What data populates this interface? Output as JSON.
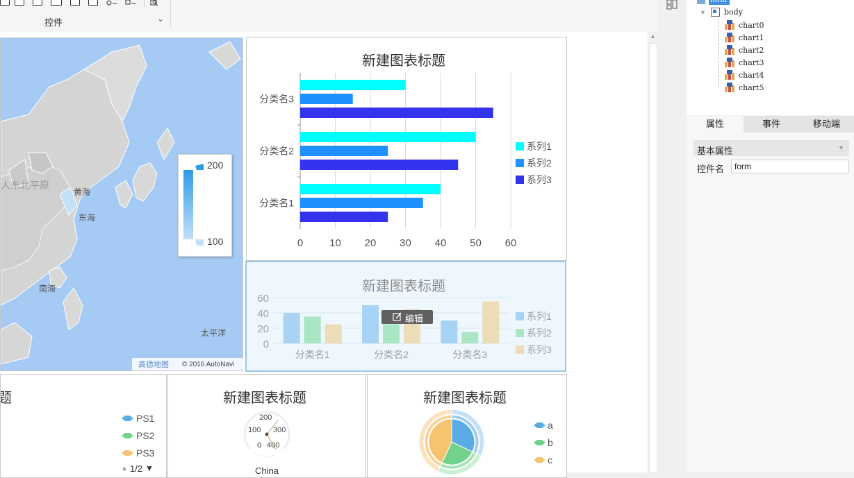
{
  "toolbar": {
    "section_label": "控件",
    "icons": [
      "insert-icon",
      "frame-icon",
      "layout-icon",
      "grid-icon",
      "image-icon",
      "text-icon",
      "radio-icon",
      "checkbox-icon",
      "preview-icon"
    ]
  },
  "map": {
    "labels": {
      "yellow_sea": "黄海",
      "east_sea": "东海",
      "south_sea": "南海",
      "pacific": "太平洋",
      "region": "人东北平原"
    },
    "legend": {
      "max": "200",
      "min": "100"
    },
    "attribution": {
      "provider": "高德地图",
      "copyright": "© 2016 AutoNavi"
    }
  },
  "chart_data": [
    {
      "type": "bar",
      "orientation": "horizontal",
      "title": "新建图表标题",
      "categories": [
        "分类名1",
        "分类名2",
        "分类名3"
      ],
      "series": [
        {
          "name": "系列1",
          "values": [
            40,
            50,
            30
          ],
          "color": "#00ffff"
        },
        {
          "name": "系列2",
          "values": [
            35,
            25,
            15
          ],
          "color": "#1e90ff"
        },
        {
          "name": "系列3",
          "values": [
            25,
            45,
            55
          ],
          "color": "#3333ee"
        }
      ],
      "xlim": [
        0,
        60
      ],
      "ticks": [
        "0",
        "10",
        "20",
        "30",
        "40",
        "50",
        "60"
      ],
      "grid": true,
      "legend_position": "right"
    },
    {
      "type": "bar",
      "orientation": "vertical",
      "title": "新建图表标题",
      "categories": [
        "分类名1",
        "分类名2",
        "分类名3"
      ],
      "series": [
        {
          "name": "系列1",
          "values": [
            40,
            50,
            30
          ],
          "color": "#a9d3f5"
        },
        {
          "name": "系列2",
          "values": [
            35,
            25,
            15
          ],
          "color": "#a8e6c4"
        },
        {
          "name": "系列3",
          "values": [
            25,
            45,
            55
          ],
          "color": "#ecdcb8"
        }
      ],
      "ylim": [
        0,
        60
      ],
      "ticks": [
        "0",
        "20",
        "40",
        "60"
      ],
      "grid": true,
      "legend_position": "right",
      "selected": true
    },
    {
      "type": "gauge",
      "title": "新建图表标题",
      "tick_labels": [
        "0",
        "100",
        "200",
        "300",
        "400"
      ],
      "category": "China"
    },
    {
      "type": "pie",
      "title": "新建图表标题",
      "legend": [
        {
          "name": "a",
          "color": "#5aace6"
        },
        {
          "name": "b",
          "color": "#72d28c"
        },
        {
          "name": "c",
          "color": "#f5c46e"
        }
      ],
      "legend_position": "right"
    }
  ],
  "bottom_left": {
    "title_fragment": "题",
    "legend": [
      {
        "name": "PS1",
        "color": "#5aace6"
      },
      {
        "name": "PS2",
        "color": "#72d28c"
      },
      {
        "name": "PS3",
        "color": "#f5c46e"
      }
    ],
    "pager": "1/2"
  },
  "edit_button": {
    "label": "编辑"
  },
  "tree": {
    "root": "form",
    "body": "body",
    "children": [
      "chart0",
      "chart1",
      "chart2",
      "chart3",
      "chart4",
      "chart5"
    ]
  },
  "tabs": [
    "属性",
    "事件",
    "移动端"
  ],
  "properties": {
    "section": "基本属性",
    "name_label": "控件名",
    "name_value": "form"
  },
  "colors": {
    "accent": "#1e90ff",
    "selection": "#9ac6e8",
    "map_sea": "#a5cbf5"
  }
}
